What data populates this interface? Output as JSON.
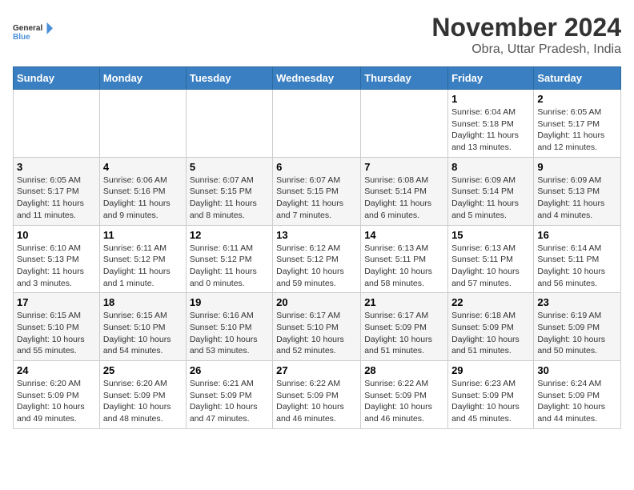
{
  "logo": {
    "line1": "General",
    "line2": "Blue"
  },
  "title": "November 2024",
  "subtitle": "Obra, Uttar Pradesh, India",
  "days_of_week": [
    "Sunday",
    "Monday",
    "Tuesday",
    "Wednesday",
    "Thursday",
    "Friday",
    "Saturday"
  ],
  "weeks": [
    [
      {
        "day": "",
        "info": ""
      },
      {
        "day": "",
        "info": ""
      },
      {
        "day": "",
        "info": ""
      },
      {
        "day": "",
        "info": ""
      },
      {
        "day": "",
        "info": ""
      },
      {
        "day": "1",
        "info": "Sunrise: 6:04 AM\nSunset: 5:18 PM\nDaylight: 11 hours\nand 13 minutes."
      },
      {
        "day": "2",
        "info": "Sunrise: 6:05 AM\nSunset: 5:17 PM\nDaylight: 11 hours\nand 12 minutes."
      }
    ],
    [
      {
        "day": "3",
        "info": "Sunrise: 6:05 AM\nSunset: 5:17 PM\nDaylight: 11 hours\nand 11 minutes."
      },
      {
        "day": "4",
        "info": "Sunrise: 6:06 AM\nSunset: 5:16 PM\nDaylight: 11 hours\nand 9 minutes."
      },
      {
        "day": "5",
        "info": "Sunrise: 6:07 AM\nSunset: 5:15 PM\nDaylight: 11 hours\nand 8 minutes."
      },
      {
        "day": "6",
        "info": "Sunrise: 6:07 AM\nSunset: 5:15 PM\nDaylight: 11 hours\nand 7 minutes."
      },
      {
        "day": "7",
        "info": "Sunrise: 6:08 AM\nSunset: 5:14 PM\nDaylight: 11 hours\nand 6 minutes."
      },
      {
        "day": "8",
        "info": "Sunrise: 6:09 AM\nSunset: 5:14 PM\nDaylight: 11 hours\nand 5 minutes."
      },
      {
        "day": "9",
        "info": "Sunrise: 6:09 AM\nSunset: 5:13 PM\nDaylight: 11 hours\nand 4 minutes."
      }
    ],
    [
      {
        "day": "10",
        "info": "Sunrise: 6:10 AM\nSunset: 5:13 PM\nDaylight: 11 hours\nand 3 minutes."
      },
      {
        "day": "11",
        "info": "Sunrise: 6:11 AM\nSunset: 5:12 PM\nDaylight: 11 hours\nand 1 minute."
      },
      {
        "day": "12",
        "info": "Sunrise: 6:11 AM\nSunset: 5:12 PM\nDaylight: 11 hours\nand 0 minutes."
      },
      {
        "day": "13",
        "info": "Sunrise: 6:12 AM\nSunset: 5:12 PM\nDaylight: 10 hours\nand 59 minutes."
      },
      {
        "day": "14",
        "info": "Sunrise: 6:13 AM\nSunset: 5:11 PM\nDaylight: 10 hours\nand 58 minutes."
      },
      {
        "day": "15",
        "info": "Sunrise: 6:13 AM\nSunset: 5:11 PM\nDaylight: 10 hours\nand 57 minutes."
      },
      {
        "day": "16",
        "info": "Sunrise: 6:14 AM\nSunset: 5:11 PM\nDaylight: 10 hours\nand 56 minutes."
      }
    ],
    [
      {
        "day": "17",
        "info": "Sunrise: 6:15 AM\nSunset: 5:10 PM\nDaylight: 10 hours\nand 55 minutes."
      },
      {
        "day": "18",
        "info": "Sunrise: 6:15 AM\nSunset: 5:10 PM\nDaylight: 10 hours\nand 54 minutes."
      },
      {
        "day": "19",
        "info": "Sunrise: 6:16 AM\nSunset: 5:10 PM\nDaylight: 10 hours\nand 53 minutes."
      },
      {
        "day": "20",
        "info": "Sunrise: 6:17 AM\nSunset: 5:10 PM\nDaylight: 10 hours\nand 52 minutes."
      },
      {
        "day": "21",
        "info": "Sunrise: 6:17 AM\nSunset: 5:09 PM\nDaylight: 10 hours\nand 51 minutes."
      },
      {
        "day": "22",
        "info": "Sunrise: 6:18 AM\nSunset: 5:09 PM\nDaylight: 10 hours\nand 51 minutes."
      },
      {
        "day": "23",
        "info": "Sunrise: 6:19 AM\nSunset: 5:09 PM\nDaylight: 10 hours\nand 50 minutes."
      }
    ],
    [
      {
        "day": "24",
        "info": "Sunrise: 6:20 AM\nSunset: 5:09 PM\nDaylight: 10 hours\nand 49 minutes."
      },
      {
        "day": "25",
        "info": "Sunrise: 6:20 AM\nSunset: 5:09 PM\nDaylight: 10 hours\nand 48 minutes."
      },
      {
        "day": "26",
        "info": "Sunrise: 6:21 AM\nSunset: 5:09 PM\nDaylight: 10 hours\nand 47 minutes."
      },
      {
        "day": "27",
        "info": "Sunrise: 6:22 AM\nSunset: 5:09 PM\nDaylight: 10 hours\nand 46 minutes."
      },
      {
        "day": "28",
        "info": "Sunrise: 6:22 AM\nSunset: 5:09 PM\nDaylight: 10 hours\nand 46 minutes."
      },
      {
        "day": "29",
        "info": "Sunrise: 6:23 AM\nSunset: 5:09 PM\nDaylight: 10 hours\nand 45 minutes."
      },
      {
        "day": "30",
        "info": "Sunrise: 6:24 AM\nSunset: 5:09 PM\nDaylight: 10 hours\nand 44 minutes."
      }
    ]
  ]
}
